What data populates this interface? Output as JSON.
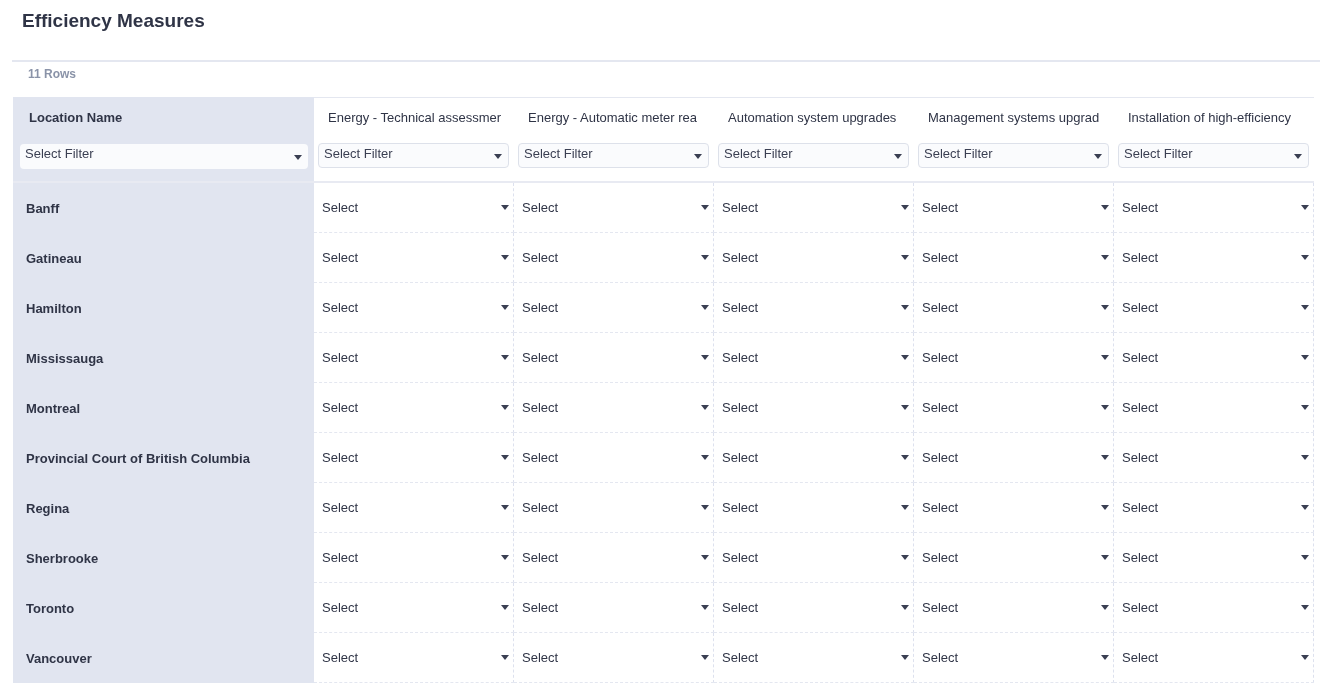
{
  "title": "Efficiency Measures",
  "row_count": "11 Rows",
  "table": {
    "columns": [
      {
        "label": "Location Name",
        "filter_placeholder": "Select Filter"
      },
      {
        "label": "Energy - Technical assessmer",
        "filter_placeholder": "Select Filter"
      },
      {
        "label": "Energy - Automatic meter rea",
        "filter_placeholder": "Select Filter"
      },
      {
        "label": "Automation system upgrades",
        "filter_placeholder": "Select Filter"
      },
      {
        "label": "Management systems upgrad",
        "filter_placeholder": "Select Filter"
      },
      {
        "label": "Installation of high-efficiency",
        "filter_placeholder": "Select Filter"
      }
    ],
    "rows": [
      {
        "cells": [
          "Banff",
          "Select",
          "Select",
          "Select",
          "Select",
          "Select"
        ]
      },
      {
        "cells": [
          "Gatineau",
          "Select",
          "Select",
          "Select",
          "Select",
          "Select"
        ]
      },
      {
        "cells": [
          "Hamilton",
          "Select",
          "Select",
          "Select",
          "Select",
          "Select"
        ]
      },
      {
        "cells": [
          "Mississauga",
          "Select",
          "Select",
          "Select",
          "Select",
          "Select"
        ]
      },
      {
        "cells": [
          "Montreal",
          "Select",
          "Select",
          "Select",
          "Select",
          "Select"
        ]
      },
      {
        "cells": [
          "Provincial Court of British Columbia",
          "Select",
          "Select",
          "Select",
          "Select",
          "Select"
        ]
      },
      {
        "cells": [
          "Regina",
          "Select",
          "Select",
          "Select",
          "Select",
          "Select"
        ]
      },
      {
        "cells": [
          "Sherbrooke",
          "Select",
          "Select",
          "Select",
          "Select",
          "Select"
        ]
      },
      {
        "cells": [
          "Toronto",
          "Select",
          "Select",
          "Select",
          "Select",
          "Select"
        ]
      },
      {
        "cells": [
          "Vancouver",
          "Select",
          "Select",
          "Select",
          "Select",
          "Select"
        ]
      }
    ]
  }
}
